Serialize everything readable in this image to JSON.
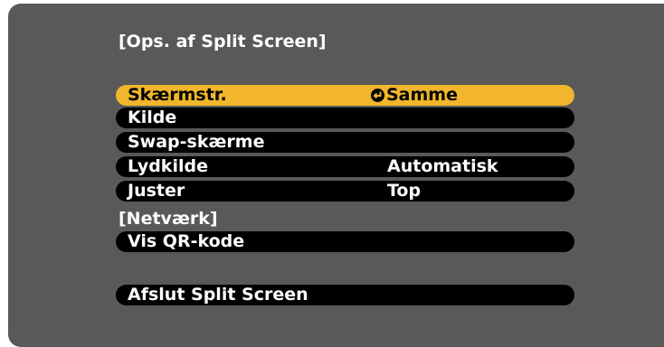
{
  "menu": {
    "title": "[Ops. af Split Screen]",
    "items": [
      {
        "label": "Skærmstr.",
        "value": "Samme",
        "icon": "enter-icon",
        "selected": true
      },
      {
        "label": "Kilde",
        "value": ""
      },
      {
        "label": "Swap-skærme",
        "value": ""
      },
      {
        "label": "Lydkilde",
        "value": "Automatisk"
      },
      {
        "label": "Juster",
        "value": "Top"
      }
    ],
    "network_section": "[Netværk]",
    "network_items": [
      {
        "label": "Vis QR-kode"
      }
    ],
    "exit_label": "Afslut Split Screen"
  },
  "colors": {
    "background": "#595959",
    "row": "#000000",
    "selected_row": "#f1b62b"
  }
}
